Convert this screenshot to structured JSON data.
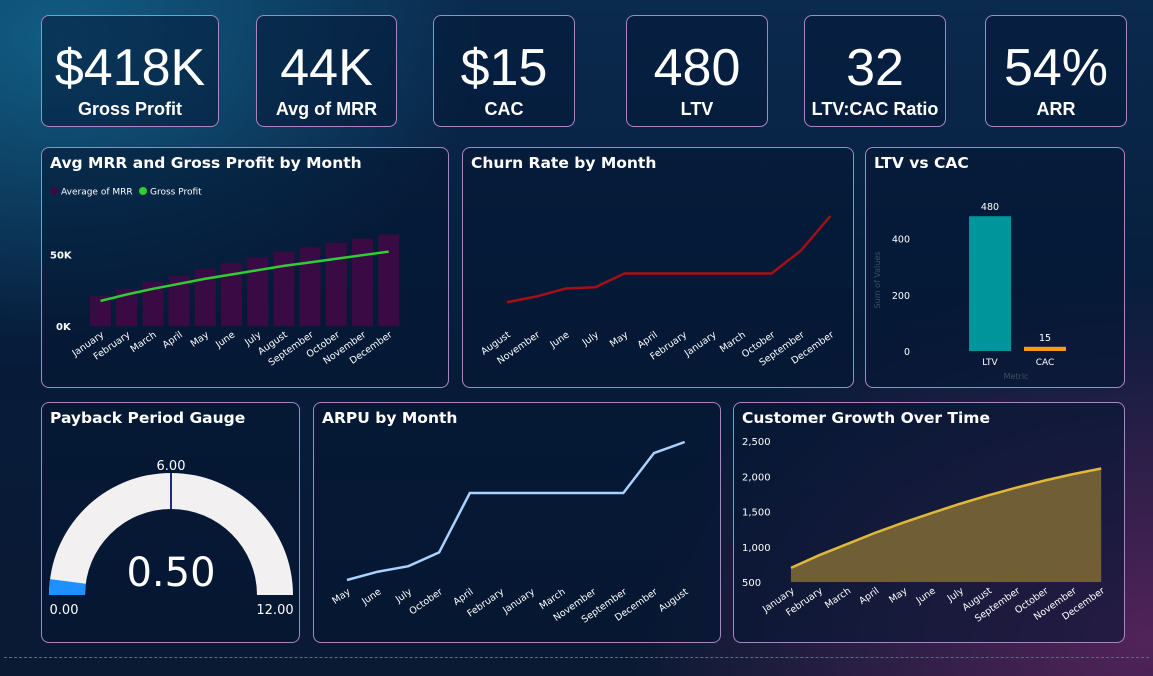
{
  "kpis": [
    {
      "value": "$418K",
      "label": "Gross Profit"
    },
    {
      "value": "44K",
      "label": "Avg of MRR"
    },
    {
      "value": "$15",
      "label": "CAC"
    },
    {
      "value": "480",
      "label": "LTV"
    },
    {
      "value": "32",
      "label": "LTV:CAC Ratio"
    },
    {
      "value": "54%",
      "label": "ARR"
    }
  ],
  "colors": {
    "mrr_bar": "#3a0a45",
    "gross_profit": "#32cd32",
    "churn": "#a50f15",
    "ltv": "#00959a",
    "cac": "#f59a1b",
    "arpu": "#a8d2ff",
    "growth_line": "#e0b93a",
    "growth_fill": "#7a6636",
    "gauge_track": "#f2f0f0",
    "gauge_fill": "#1e90ff",
    "gauge_target": "#1c2e7a"
  },
  "chart_data": [
    {
      "type": "bar",
      "title": "Avg MRR and Gross Profit by Month",
      "categories": [
        "January",
        "February",
        "March",
        "April",
        "May",
        "June",
        "July",
        "August",
        "September",
        "October",
        "November",
        "December"
      ],
      "yticks": [
        "0K",
        "50K"
      ],
      "ylim": [
        0,
        65000
      ],
      "grid": false,
      "legend": "top-left",
      "series": [
        {
          "name": "Average of MRR",
          "type": "bar",
          "values": [
            21000,
            26000,
            31000,
            35000,
            40000,
            44000,
            48000,
            52000,
            55000,
            58000,
            61000,
            64000
          ]
        },
        {
          "name": "Gross Profit",
          "type": "line",
          "values": [
            17500,
            22000,
            26000,
            29500,
            33000,
            36000,
            39000,
            42000,
            44500,
            47000,
            49500,
            52000
          ]
        }
      ]
    },
    {
      "type": "line",
      "title": "Churn Rate by Month",
      "categories": [
        "August",
        "November",
        "June",
        "July",
        "May",
        "April",
        "February",
        "January",
        "March",
        "October",
        "September",
        "December"
      ],
      "ylim": [
        0,
        1
      ],
      "grid": false,
      "series": [
        {
          "values": [
            0.05,
            0.1,
            0.17,
            0.18,
            0.3,
            0.3,
            0.3,
            0.3,
            0.3,
            0.3,
            0.5,
            0.8
          ]
        }
      ]
    },
    {
      "type": "bar",
      "title": "LTV vs CAC",
      "categories": [
        "LTV",
        "CAC"
      ],
      "values": [
        480,
        15
      ],
      "ylim": [
        0,
        520
      ],
      "yticks": [
        0,
        200,
        400
      ],
      "xlabel": "Metric",
      "ylabel": "Sum of Values",
      "grid": false
    },
    {
      "type": "gauge",
      "title": "Payback Period Gauge",
      "value": 0.5,
      "value_label": "0.50",
      "min": 0,
      "max": 12,
      "min_label": "0.00",
      "max_label": "12.00",
      "target": 6,
      "target_label": "6.00"
    },
    {
      "type": "line",
      "title": "ARPU by Month",
      "categories": [
        "May",
        "June",
        "July",
        "October",
        "April",
        "February",
        "January",
        "March",
        "November",
        "September",
        "December",
        "August"
      ],
      "ylim": [
        0,
        1
      ],
      "grid": false,
      "series": [
        {
          "values": [
            0.0,
            0.06,
            0.1,
            0.2,
            0.63,
            0.63,
            0.63,
            0.63,
            0.63,
            0.63,
            0.92,
            1.0
          ]
        }
      ]
    },
    {
      "type": "area",
      "title": "Customer Growth Over Time",
      "categories": [
        "January",
        "February",
        "March",
        "April",
        "May",
        "June",
        "July",
        "August",
        "September",
        "October",
        "November",
        "December"
      ],
      "values": [
        700,
        880,
        1040,
        1200,
        1345,
        1480,
        1610,
        1730,
        1840,
        1940,
        2030,
        2110
      ],
      "ylim": [
        500,
        2500
      ],
      "yticks": [
        "500",
        "1,000",
        "1,500",
        "2,000",
        "2,500"
      ],
      "grid": false
    }
  ]
}
